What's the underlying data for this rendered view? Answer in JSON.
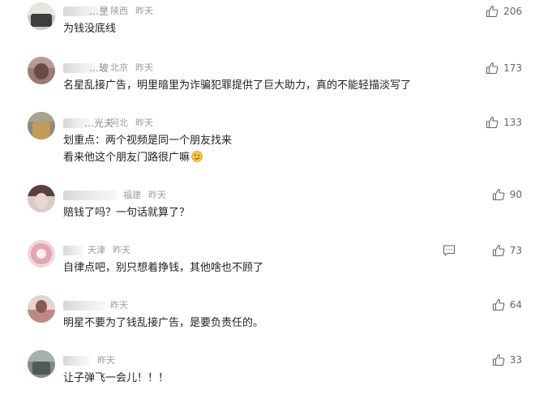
{
  "comments": [
    {
      "name_tail": "…昰",
      "location": "陕西",
      "time": "昨天",
      "text": [
        "为钱没底线"
      ],
      "likes": "206"
    },
    {
      "name_tail": "…玻",
      "location": "北京",
      "time": "昨天",
      "text": [
        "名星乱接广告，明里暗里为诈骗犯罪提供了巨大助力，真的不能轻描淡写了"
      ],
      "likes": "173"
    },
    {
      "name_tail": "…光夫",
      "location": "河北",
      "time": "昨天",
      "text": [
        "划重点：两个视频是同一个朋友找来",
        "看来他这个朋友门路很广嘛"
      ],
      "likes": "133",
      "emoji": "smirk-emoji"
    },
    {
      "name_tail": "",
      "location": "福建",
      "time": "昨天",
      "text": [
        "赔钱了吗？一句话就算了？"
      ],
      "likes": "90"
    },
    {
      "name_tail": "",
      "location": "天津",
      "time": "昨天",
      "text": [
        "自律点吧，别只想着挣钱，其他啥也不顾了"
      ],
      "likes": "73",
      "show_reply_icon": true
    },
    {
      "name_tail": "",
      "location": "",
      "time": "昨天",
      "text": [
        "明星不要为了钱乱接广告，是要负责任的。"
      ],
      "likes": "64"
    },
    {
      "name_tail": "",
      "location": "",
      "time": "昨天",
      "text": [
        "让子弹飞一会儿！！！"
      ],
      "likes": "33"
    }
  ],
  "icons": {
    "like": "thumbs-up-icon",
    "reply": "comment-icon"
  }
}
